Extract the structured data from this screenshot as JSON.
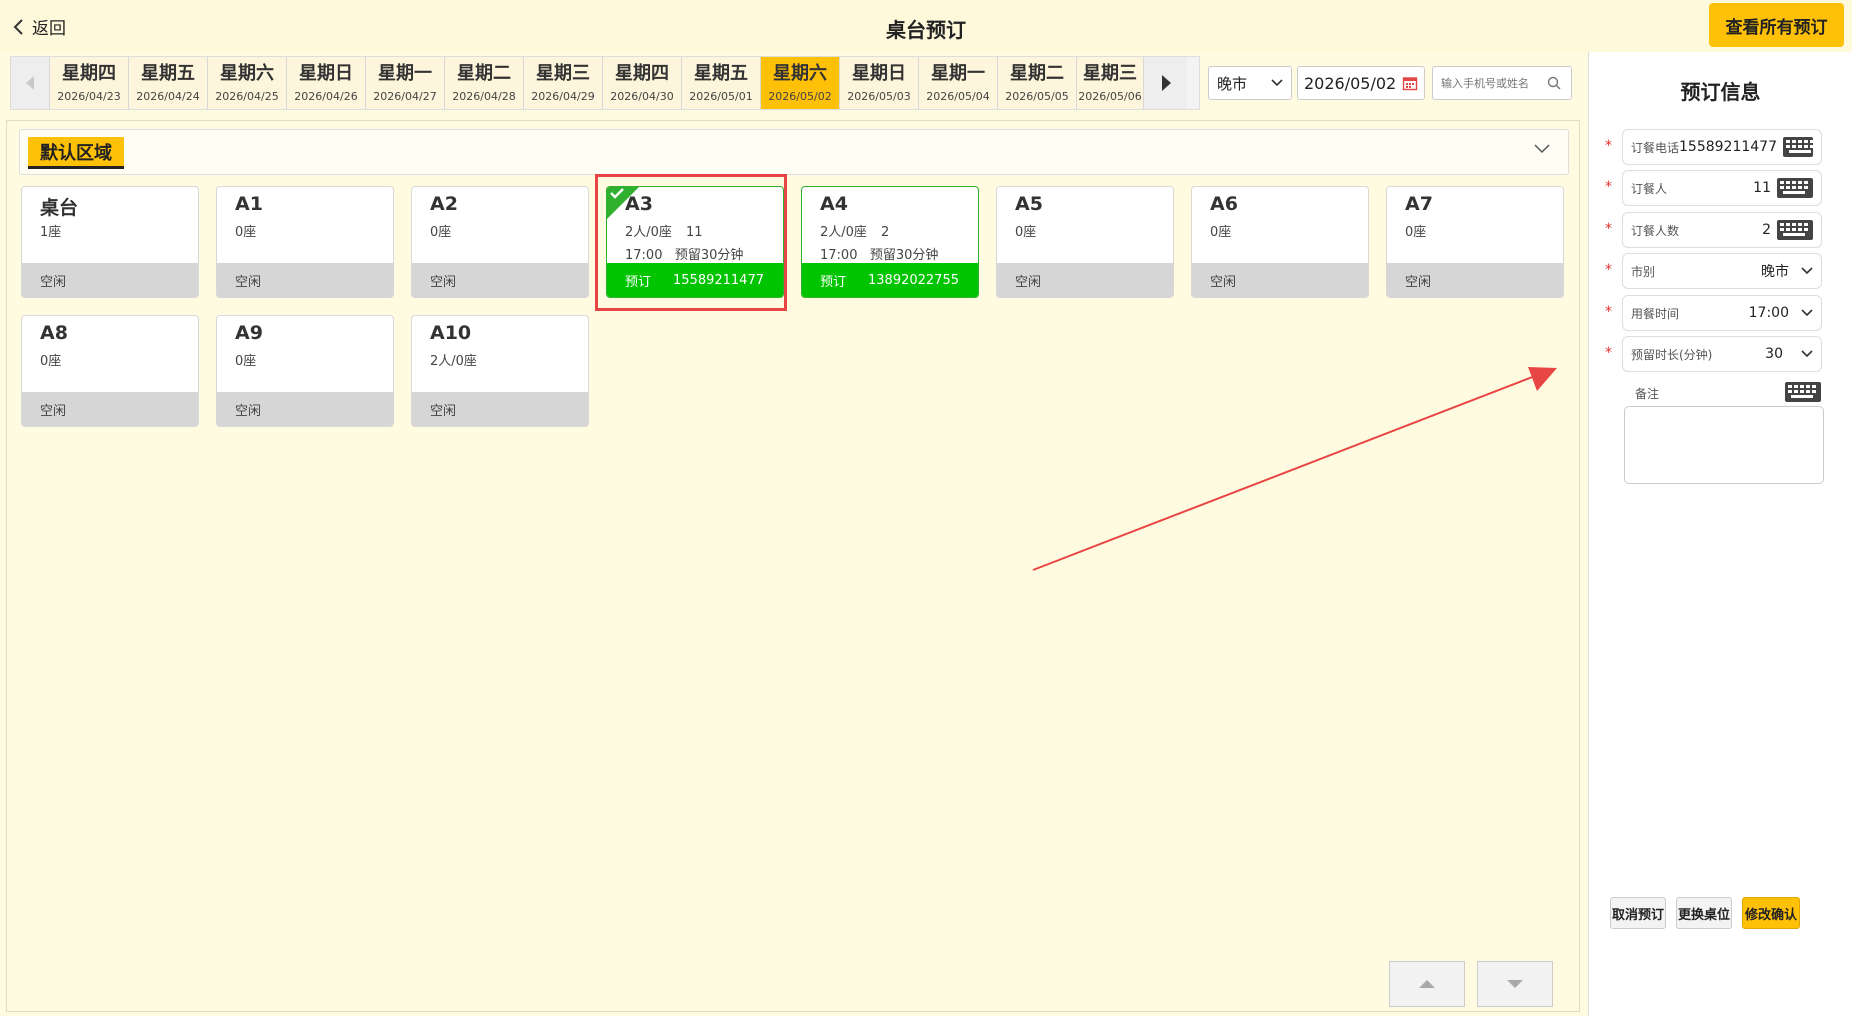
{
  "header": {
    "back_label": "返回",
    "title": "桌台预订",
    "view_all_label": "查看所有预订"
  },
  "date_strip": {
    "days": [
      {
        "weekday": "星期四",
        "date": "2026/04/23"
      },
      {
        "weekday": "星期五",
        "date": "2026/04/24"
      },
      {
        "weekday": "星期六",
        "date": "2026/04/25"
      },
      {
        "weekday": "星期日",
        "date": "2026/04/26"
      },
      {
        "weekday": "星期一",
        "date": "2026/04/27"
      },
      {
        "weekday": "星期二",
        "date": "2026/04/28"
      },
      {
        "weekday": "星期三",
        "date": "2026/04/29"
      },
      {
        "weekday": "星期四",
        "date": "2026/04/30"
      },
      {
        "weekday": "星期五",
        "date": "2026/05/01"
      },
      {
        "weekday": "星期六",
        "date": "2026/05/02"
      },
      {
        "weekday": "星期日",
        "date": "2026/05/03"
      },
      {
        "weekday": "星期一",
        "date": "2026/05/04"
      },
      {
        "weekday": "星期二",
        "date": "2026/05/05"
      },
      {
        "weekday": "星期三",
        "date": "2026/05/06"
      }
    ],
    "selected_date": "2026/05/02"
  },
  "filters": {
    "meal": "晚市",
    "date": "2026/05/02",
    "search_placeholder": "输入手机号或姓名"
  },
  "area": {
    "name": "默认区域"
  },
  "tables": [
    {
      "name": "桌台",
      "seats": "1座",
      "status": "空闲"
    },
    {
      "name": "A1",
      "seats": "0座",
      "status": "空闲"
    },
    {
      "name": "A2",
      "seats": "0座",
      "status": "空闲"
    },
    {
      "name": "A3",
      "seats": "2人/0座",
      "seats_extra": "11",
      "time": "17:00",
      "reserve": "预留30分钟",
      "status": "预订",
      "phone": "15589211477",
      "selected": true
    },
    {
      "name": "A4",
      "seats": "2人/0座",
      "seats_extra": "2",
      "time": "17:00",
      "reserve": "预留30分钟",
      "status": "预订",
      "phone": "13892022755"
    },
    {
      "name": "A5",
      "seats": "0座",
      "status": "空闲"
    },
    {
      "name": "A6",
      "seats": "0座",
      "status": "空闲"
    },
    {
      "name": "A7",
      "seats": "0座",
      "status": "空闲"
    },
    {
      "name": "A8",
      "seats": "0座",
      "status": "空闲"
    },
    {
      "name": "A9",
      "seats": "0座",
      "status": "空闲"
    },
    {
      "name": "A10",
      "seats": "2人/0座",
      "status": "空闲"
    }
  ],
  "booking_panel": {
    "title": "预订信息",
    "phone_label": "订餐电话",
    "phone_value": "15589211477",
    "guest_label": "订餐人",
    "guest_value": "11",
    "count_label": "订餐人数",
    "count_value": "2",
    "meal_label": "市别",
    "meal_value": "晚市",
    "time_label": "用餐时间",
    "time_value": "17:00",
    "hold_label": "预留时长(分钟)",
    "hold_value": "30",
    "note_label": "备注",
    "note_value": "",
    "cancel_label": "取消预订",
    "change_label": "更换桌位",
    "confirm_label": "修改确认"
  },
  "colors": {
    "accent": "#ffc107",
    "booked": "#00c400",
    "idle": "#d6d6d6",
    "highlight": "#e84545"
  }
}
